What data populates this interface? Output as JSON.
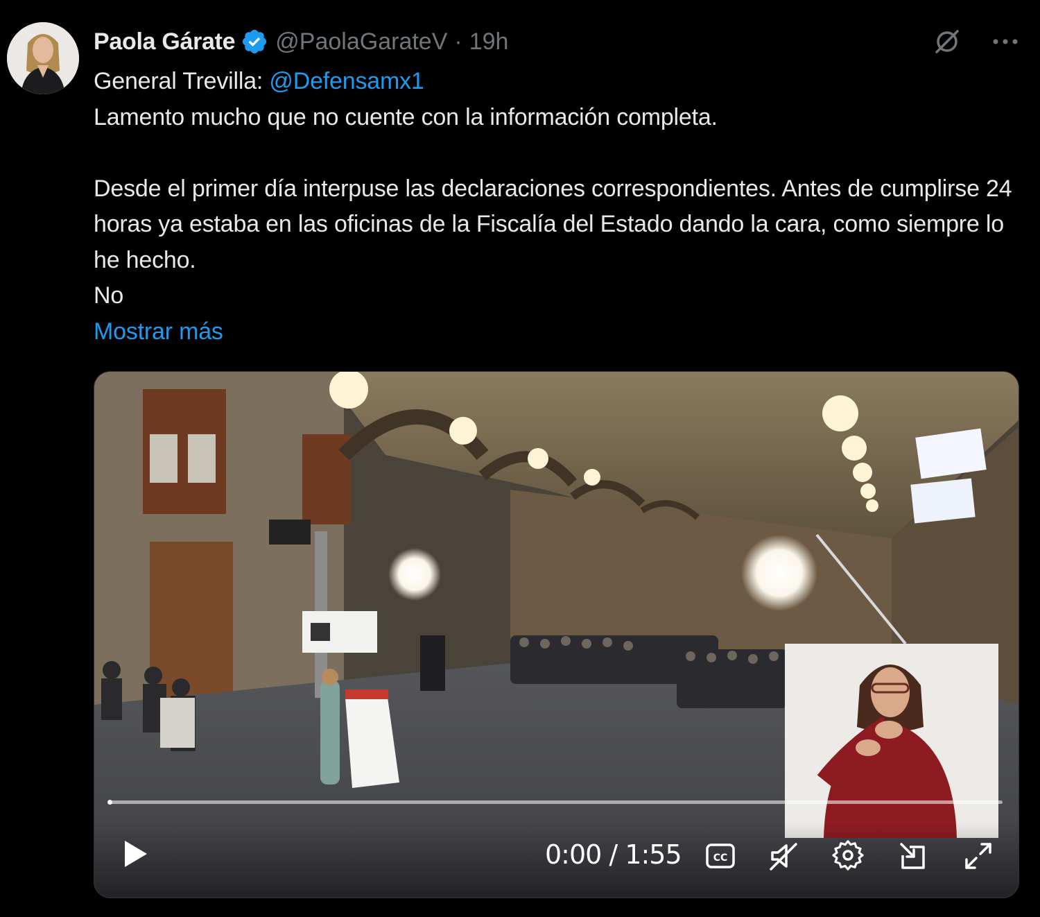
{
  "author": {
    "name": "Paola Gárate",
    "handle": "@PaolaGarateV",
    "separator": "·",
    "time": "19h",
    "verified": true,
    "verified_color": "#1d9bf0"
  },
  "actions": {
    "grok_icon": "slash-circle-icon",
    "more_icon": "more-icon"
  },
  "tweet": {
    "prefix": "General Trevilla: ",
    "mention": "@Defensamx1",
    "line2": "Lamento mucho que no cuente con la información completa.",
    "paragraph2": "Desde el primer día interpuse las declaraciones correspondientes. Antes de cumplirse 24 horas ya estaba en las oficinas de la Fiscalía del Estado dando la cara, como siempre lo he hecho.",
    "line_last": "No",
    "show_more": "Mostrar más"
  },
  "video": {
    "current_time": "0:00",
    "time_separator": " / ",
    "duration": "1:55",
    "progress": 0,
    "controls": [
      "play-icon",
      "captions-icon",
      "mute-icon",
      "settings-icon",
      "pop-out-icon",
      "fullscreen-icon"
    ]
  },
  "colors": {
    "background": "#000000",
    "text": "#e7e9ea",
    "secondary": "#71767b",
    "link": "#1d9bf0"
  }
}
